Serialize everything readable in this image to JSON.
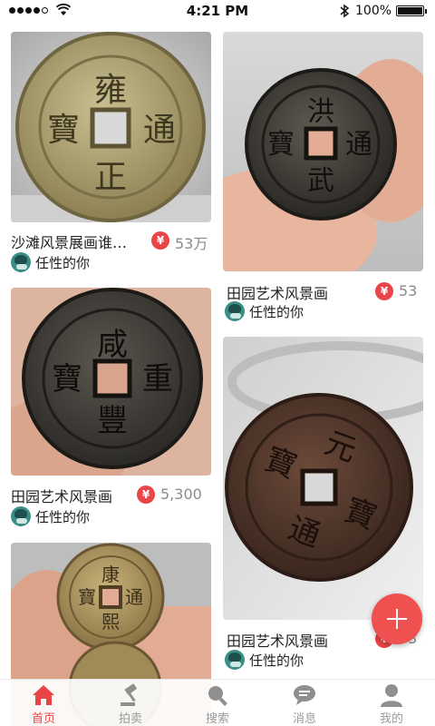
{
  "status_bar": {
    "time": "4:21 PM",
    "battery_text": "100%",
    "battery_level": 1.0,
    "signal_bars_filled": 4,
    "signal_bars_total": 5
  },
  "cards": [
    {
      "title": "沙滩风景展画谁…",
      "currency": "¥",
      "price": "53万",
      "username": "任性的你",
      "image": "coin-photo"
    },
    {
      "title": "田园艺术风景画",
      "currency": "¥",
      "price": "53",
      "username": "任性的你",
      "image": "coin-photo"
    },
    {
      "title": "田园艺术风景画",
      "currency": "¥",
      "price": "5,300",
      "username": "任性的你",
      "image": "coin-photo"
    },
    {
      "title": "田园艺术风景画",
      "currency": "¥",
      "price": "53",
      "username": "任性的你",
      "image": "coin-photo"
    },
    {
      "title": "",
      "currency": "",
      "price": "",
      "username": "",
      "image": "coin-photo"
    }
  ],
  "coin_inscriptions": [
    [
      "雍",
      "通",
      "正",
      "寶"
    ],
    [
      "洪",
      "通",
      "武",
      "寶"
    ],
    [
      "咸",
      "重",
      "豐",
      "寶"
    ],
    [
      "元",
      "寶",
      "通",
      "寶"
    ],
    [
      "康",
      "通",
      "熙",
      "寶"
    ]
  ],
  "fab": {
    "icon": "plus-icon"
  },
  "tab_bar": {
    "active_index": 0,
    "accent_color": "#e94448",
    "tabs": [
      {
        "label": "首页",
        "icon": "home-icon"
      },
      {
        "label": "拍卖",
        "icon": "gavel-icon"
      },
      {
        "label": "搜索",
        "icon": "search-icon"
      },
      {
        "label": "消息",
        "icon": "message-icon"
      },
      {
        "label": "我的",
        "icon": "profile-icon"
      }
    ]
  }
}
